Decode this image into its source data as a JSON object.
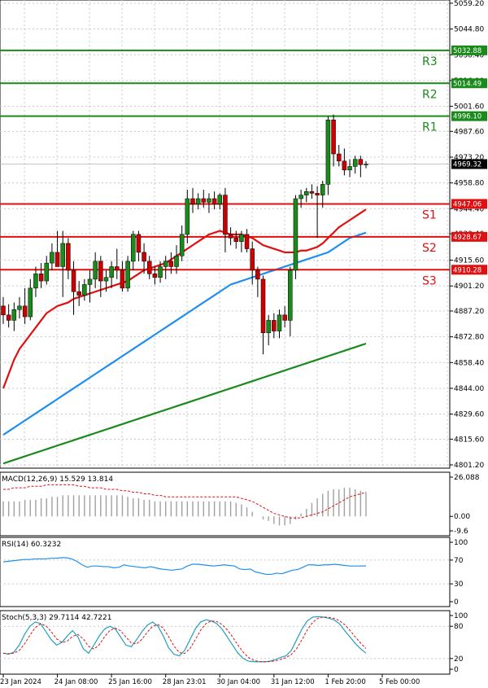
{
  "chart_data": [
    {
      "type": "candlestick",
      "panel": "price",
      "ylim": [
        4801.2,
        5059.2
      ],
      "y_ticks": [
        5059.2,
        5044.8,
        5030.4,
        5016.0,
        5001.6,
        4987.6,
        4973.2,
        4958.8,
        4944.4,
        4930.4,
        4915.6,
        4901.2,
        4887.2,
        4872.8,
        4858.4,
        4844.0,
        4829.6,
        4815.6,
        4801.2
      ],
      "y_tick_labels": [
        "5059.20",
        "5044.80",
        "5030.40",
        "5016.00",
        "5001.60",
        "4987.60",
        "4973.20",
        "4958.80",
        "4944.40",
        "4930.40",
        "4915.60",
        "4901.20",
        "4887.20",
        "4872.80",
        "4858.40",
        "4844.00",
        "4829.60",
        "4815.60",
        "4801.20"
      ],
      "x_tick_labels": [
        "23 Jan 2024",
        "24 Jan 08:00",
        "25 Jan 16:00",
        "28 Jan 23:01",
        "30 Jan 04:00",
        "31 Jan 12:00",
        "1 Feb 20:00",
        "5 Feb 00:00"
      ],
      "x_tick_candle_index": [
        0,
        10,
        20,
        30,
        40,
        50,
        60,
        70
      ],
      "current_price": 4969.32,
      "current_price_label": "4969.32",
      "grid": true,
      "candles": [
        [
          4890,
          4895,
          4880,
          4885
        ],
        [
          4885,
          4891,
          4878,
          4882
        ],
        [
          4882,
          4892,
          4876,
          4888
        ],
        [
          4888,
          4895,
          4883,
          4890
        ],
        [
          4890,
          4900,
          4880,
          4884
        ],
        [
          4884,
          4905,
          4882,
          4900
        ],
        [
          4900,
          4912,
          4895,
          4908
        ],
        [
          4908,
          4914,
          4900,
          4904
        ],
        [
          4904,
          4918,
          4902,
          4914
        ],
        [
          4914,
          4925,
          4910,
          4920
        ],
        [
          4920,
          4932,
          4915,
          4912
        ],
        [
          4912,
          4932,
          4895,
          4925
        ],
        [
          4925,
          4928,
          4905,
          4910
        ],
        [
          4910,
          4915,
          4885,
          4898
        ],
        [
          4898,
          4904,
          4890,
          4896
        ],
        [
          4896,
          4905,
          4893,
          4902
        ],
        [
          4902,
          4910,
          4892,
          4905
        ],
        [
          4905,
          4920,
          4900,
          4915
        ],
        [
          4915,
          4918,
          4895,
          4904
        ],
        [
          4904,
          4910,
          4898,
          4906
        ],
        [
          4906,
          4915,
          4900,
          4912
        ],
        [
          4912,
          4922,
          4905,
          4910
        ],
        [
          4910,
          4915,
          4898,
          4900
        ],
        [
          4900,
          4918,
          4898,
          4915
        ],
        [
          4915,
          4932,
          4910,
          4930
        ],
        [
          4930,
          4932,
          4915,
          4920
        ],
        [
          4920,
          4925,
          4908,
          4915
        ],
        [
          4915,
          4918,
          4905,
          4908
        ],
        [
          4908,
          4912,
          4902,
          4906
        ],
        [
          4906,
          4915,
          4903,
          4912
        ],
        [
          4912,
          4918,
          4905,
          4915
        ],
        [
          4915,
          4920,
          4908,
          4912
        ],
        [
          4912,
          4924,
          4908,
          4918
        ],
        [
          4918,
          4935,
          4915,
          4930
        ],
        [
          4930,
          4955,
          4925,
          4950
        ],
        [
          4950,
          4956,
          4942,
          4947
        ],
        [
          4947,
          4953,
          4944,
          4950
        ],
        [
          4950,
          4955,
          4945,
          4948
        ],
        [
          4948,
          4953,
          4942,
          4950
        ],
        [
          4950,
          4954,
          4944,
          4947
        ],
        [
          4947,
          4953,
          4944,
          4952
        ],
        [
          4952,
          4956,
          4920,
          4930
        ],
        [
          4930,
          4934,
          4924,
          4928
        ],
        [
          4928,
          4932,
          4922,
          4926
        ],
        [
          4926,
          4932,
          4920,
          4930
        ],
        [
          4930,
          4933,
          4920,
          4922
        ],
        [
          4922,
          4926,
          4902,
          4910
        ],
        [
          4910,
          4912,
          4895,
          4905
        ],
        [
          4905,
          4907,
          4863,
          4875
        ],
        [
          4875,
          4885,
          4868,
          4882
        ],
        [
          4882,
          4886,
          4872,
          4876
        ],
        [
          4876,
          4888,
          4872,
          4885
        ],
        [
          4885,
          4890,
          4878,
          4882
        ],
        [
          4882,
          4912,
          4873,
          4910
        ],
        [
          4910,
          4952,
          4905,
          4950
        ],
        [
          4950,
          4955,
          4945,
          4952
        ],
        [
          4952,
          4956,
          4948,
          4954
        ],
        [
          4954,
          4958,
          4950,
          4953
        ],
        [
          4953,
          4957,
          4928,
          4952
        ],
        [
          4952,
          4960,
          4945,
          4958
        ],
        [
          4958,
          4996,
          4952,
          4994
        ],
        [
          4994,
          4997,
          4968,
          4975
        ],
        [
          4975,
          4980,
          4968,
          4971
        ],
        [
          4971,
          4978,
          4963,
          4966
        ],
        [
          4966,
          4972,
          4962,
          4968
        ],
        [
          4968,
          4974,
          4964,
          4972
        ],
        [
          4972,
          4974,
          4962,
          4969
        ],
        [
          4969,
          4971,
          4967,
          4969.32
        ]
      ],
      "moving_averages": [
        {
          "color": "#e01010",
          "values": [
            4844,
            4852,
            4860,
            4866,
            4870,
            4874,
            4878,
            4882,
            4886,
            4888,
            4890,
            4891,
            4892,
            4894,
            4895,
            4896,
            4897,
            4898,
            4899,
            4900,
            4901,
            4902,
            4903,
            4904,
            4906,
            4908,
            4910,
            4911,
            4912,
            4913,
            4914,
            4916,
            4918,
            4920,
            4922,
            4924,
            4926,
            4928,
            4930,
            4931,
            4932,
            4931,
            4930,
            4930,
            4930,
            4929,
            4928,
            4926,
            4924,
            4923,
            4922,
            4921,
            4920,
            4920,
            4920,
            4921,
            4921,
            4922,
            4923,
            4925,
            4928,
            4931,
            4934,
            4936,
            4938,
            4940,
            4942,
            4944
          ]
        },
        {
          "color": "#1e8ff0",
          "values": [
            4818,
            4820,
            4822,
            4824,
            4826,
            4828,
            4830,
            4832,
            4834,
            4836,
            4838,
            4840,
            4842,
            4844,
            4846,
            4848,
            4850,
            4852,
            4854,
            4856,
            4858,
            4860,
            4862,
            4864,
            4866,
            4868,
            4870,
            4872,
            4874,
            4876,
            4878,
            4880,
            4882,
            4884,
            4886,
            4888,
            4890,
            4892,
            4894,
            4896,
            4898,
            4900,
            4902,
            4903,
            4904,
            4905,
            4906,
            4907,
            4908,
            4909,
            4910,
            4911,
            4912,
            4913,
            4914,
            4915,
            4916,
            4917,
            4918,
            4919,
            4920,
            4922,
            4924,
            4926,
            4928,
            4929,
            4930,
            4931
          ]
        },
        {
          "color": "#1a8a1a",
          "values": [
            4802,
            4803,
            4804,
            4805,
            4806,
            4807,
            4808,
            4809,
            4810,
            4811,
            4812,
            4813,
            4814,
            4815,
            4816,
            4817,
            4818,
            4819,
            4820,
            4821,
            4822,
            4823,
            4824,
            4825,
            4826,
            4827,
            4828,
            4829,
            4830,
            4831,
            4832,
            4833,
            4834,
            4835,
            4836,
            4837,
            4838,
            4839,
            4840,
            4841,
            4842,
            4843,
            4844,
            4845,
            4846,
            4847,
            4848,
            4849,
            4850,
            4851,
            4852,
            4853,
            4854,
            4855,
            4856,
            4857,
            4858,
            4859,
            4860,
            4861,
            4862,
            4863,
            4864,
            4865,
            4866,
            4867,
            4868,
            4869
          ]
        }
      ],
      "levels": [
        {
          "name": "R3",
          "value": 5032.88,
          "label": "5032.88",
          "color": "#1a8a1a"
        },
        {
          "name": "R2",
          "value": 5014.49,
          "label": "5014.49",
          "color": "#1a8a1a"
        },
        {
          "name": "R1",
          "value": 4996.1,
          "label": "4996.10",
          "color": "#1a8a1a"
        },
        {
          "name": "S1",
          "value": 4947.06,
          "label": "4947.06",
          "color": "#e01010"
        },
        {
          "name": "S2",
          "value": 4928.67,
          "label": "4928.67",
          "color": "#e01010"
        },
        {
          "name": "S3",
          "value": 4910.28,
          "label": "4910.28",
          "color": "#e01010"
        }
      ]
    },
    {
      "type": "bar",
      "panel": "macd",
      "title": "MACD(12,26,9) 15.529 13.814",
      "ylim": [
        -9.6,
        26.088
      ],
      "y_tick_labels": [
        "26.088",
        "0.00",
        "-9.6"
      ],
      "y_ticks": [
        26.088,
        0,
        -9.6
      ],
      "histogram": [
        10,
        10,
        10,
        10,
        11,
        11,
        11,
        12,
        12,
        13,
        13,
        14,
        14,
        14,
        14,
        14,
        14,
        14,
        14,
        14,
        14,
        14,
        14,
        13,
        12,
        12,
        11,
        11,
        10,
        10,
        10,
        10,
        10,
        10,
        10,
        10,
        10,
        10,
        10,
        10,
        10,
        10,
        10,
        9,
        8,
        6,
        3,
        0,
        -2,
        -3,
        -5,
        -6,
        -6,
        -5,
        -2,
        2,
        5,
        9,
        12,
        15,
        17,
        18,
        18,
        19,
        19,
        18,
        17,
        16
      ],
      "signal": [
        18,
        18,
        19,
        19,
        19,
        20,
        20,
        20,
        21,
        21,
        21,
        21,
        21,
        21,
        20,
        20,
        19,
        19,
        19,
        18,
        18,
        18,
        17,
        17,
        16,
        16,
        15,
        15,
        14,
        14,
        13,
        13,
        13,
        13,
        13,
        13,
        13,
        13,
        13,
        13,
        13,
        13,
        13,
        13,
        12,
        11,
        10,
        8,
        6,
        4,
        2,
        1,
        0,
        -1,
        -1,
        -1,
        0,
        1,
        2,
        3,
        5,
        7,
        9,
        11,
        13,
        14,
        15,
        16
      ]
    },
    {
      "type": "line",
      "panel": "rsi",
      "title": "RSI(14) 60.3232",
      "ylim": [
        0,
        100
      ],
      "y_ticks": [
        100,
        70,
        30,
        0
      ],
      "y_tick_labels": [
        "100",
        "70",
        "30",
        "0"
      ],
      "values": [
        67,
        68,
        69,
        70,
        71,
        71,
        72,
        72,
        72,
        73,
        73,
        74,
        74,
        72,
        68,
        62,
        58,
        60,
        60,
        59,
        59,
        57,
        58,
        62,
        60,
        59,
        58,
        57,
        59,
        57,
        55,
        54,
        53,
        54,
        55,
        60,
        63,
        63,
        62,
        61,
        60,
        61,
        62,
        61,
        60,
        55,
        54,
        55,
        50,
        48,
        46,
        46,
        48,
        47,
        50,
        53,
        54,
        58,
        62,
        62,
        61,
        62,
        62,
        63,
        62,
        61,
        60,
        60,
        60,
        60.3
      ]
    },
    {
      "type": "line",
      "panel": "stoch",
      "title": "Stoch(5,3,3) 29.7114 42.7221",
      "ylim": [
        0,
        100
      ],
      "y_ticks": [
        100,
        80,
        20,
        0
      ],
      "y_tick_labels": [
        "100",
        "80",
        "20",
        "0"
      ],
      "k": [
        30,
        28,
        32,
        45,
        65,
        80,
        88,
        85,
        70,
        55,
        45,
        50,
        62,
        72,
        60,
        38,
        30,
        45,
        62,
        75,
        80,
        75,
        60,
        45,
        42,
        55,
        70,
        82,
        88,
        80,
        62,
        40,
        28,
        25,
        35,
        55,
        75,
        88,
        92,
        90,
        85,
        75,
        60,
        45,
        30,
        20,
        15,
        14,
        14,
        14,
        15,
        18,
        22,
        25,
        35,
        55,
        75,
        90,
        97,
        98,
        97,
        95,
        92,
        85,
        72,
        60,
        48,
        38,
        30
      ]
    }
  ]
}
